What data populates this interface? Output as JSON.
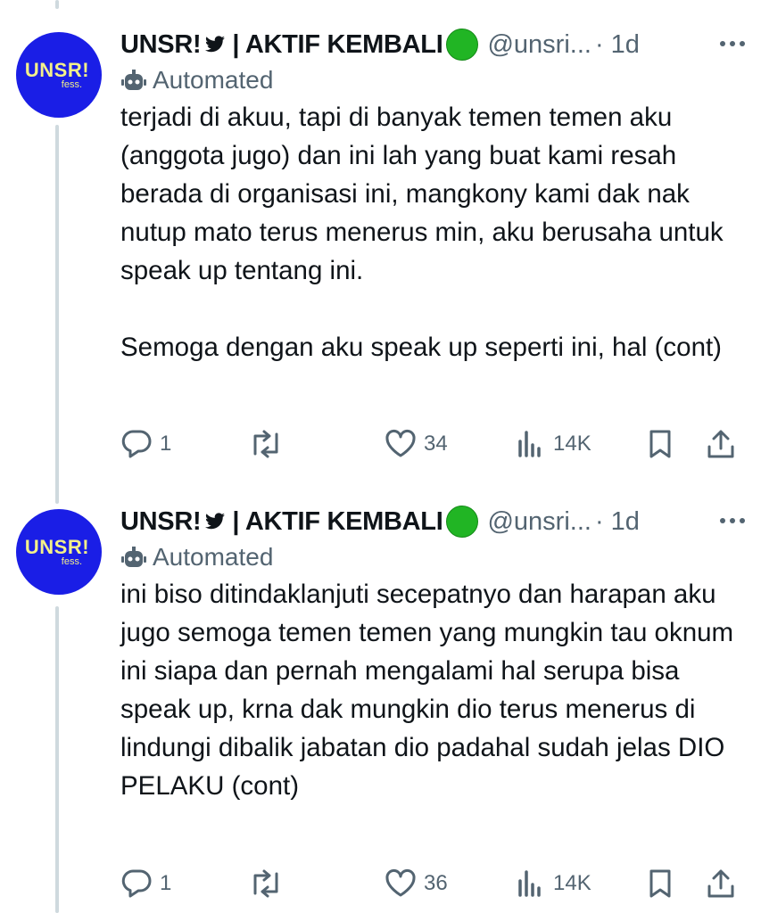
{
  "tweets": [
    {
      "author_name": "UNSR!",
      "author_suffix": "| AKTIF KEMBALI",
      "handle": "@unsri...",
      "time": "· 1d",
      "automated_label": "Automated",
      "avatar_text": "UNSR!",
      "avatar_sub": "fess.",
      "paragraphs": [
        "terjadi di akuu, tapi di banyak temen temen aku (anggota jugo) dan ini lah yang buat kami resah berada di organisasi ini, mangkony kami dak nak nutup mato terus menerus min, aku berusaha untuk speak up tentang ini.",
        "Semoga dengan aku speak up seperti ini, hal (cont)"
      ],
      "replies": "1",
      "retweets": "",
      "likes": "34",
      "views": "14K"
    },
    {
      "author_name": "UNSR!",
      "author_suffix": "| AKTIF KEMBALI",
      "handle": "@unsri...",
      "time": "· 1d",
      "automated_label": "Automated",
      "avatar_text": "UNSR!",
      "avatar_sub": "fess.",
      "paragraphs": [
        "ini biso ditindaklanjuti secepatnyo dan harapan aku jugo semoga temen temen yang mungkin tau oknum ini siapa dan pernah mengalami hal serupa bisa speak up, krna dak mungkin dio terus menerus di lindungi dibalik jabatan dio padahal sudah jelas DIO PELAKU (cont)"
      ],
      "replies": "1",
      "retweets": "",
      "likes": "36",
      "views": "14K"
    }
  ],
  "colors": {
    "avatar_bg": "#1a1ee6",
    "avatar_text": "#f3f08a",
    "status_dot": "#21b524",
    "secondary_text": "#536471",
    "primary_text": "#0f1419",
    "thread_line": "#cfd9de"
  },
  "icons": [
    "twitter-bird-icon",
    "green-circle-emoji",
    "more-options-icon",
    "bot-icon",
    "reply-icon",
    "retweet-icon",
    "like-icon",
    "views-icon",
    "bookmark-icon",
    "share-icon"
  ]
}
